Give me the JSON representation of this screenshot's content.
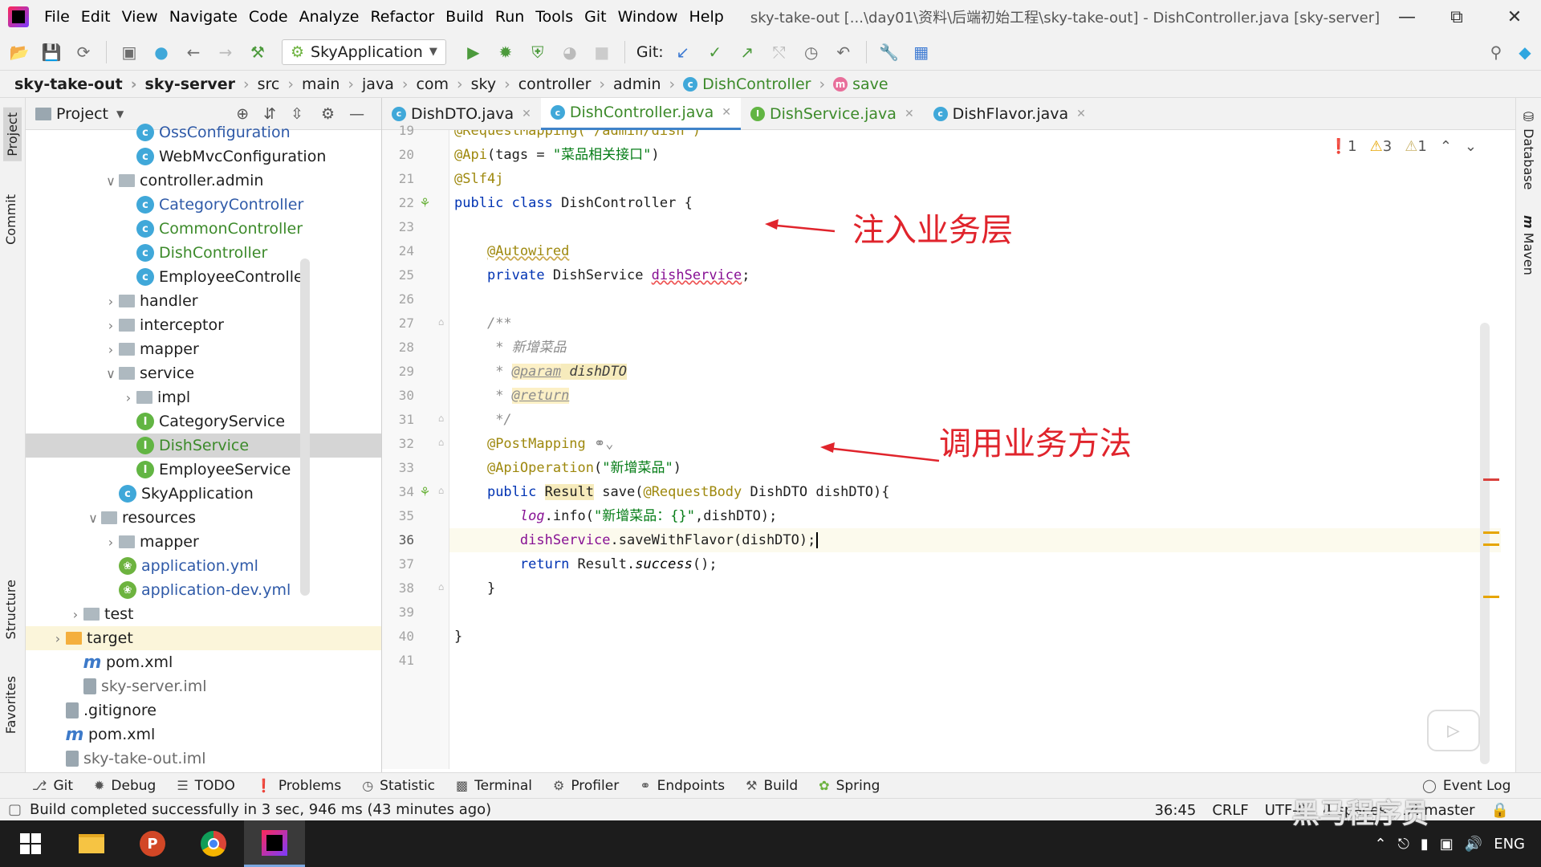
{
  "window": {
    "title": "sky-take-out [...\\day01\\资料\\后端初始工程\\sky-take-out] - DishController.java [sky-server]",
    "menu": [
      "File",
      "Edit",
      "View",
      "Navigate",
      "Code",
      "Analyze",
      "Refactor",
      "Build",
      "Run",
      "Tools",
      "Git",
      "Window",
      "Help"
    ],
    "controls": {
      "minimize": "—",
      "restore": "⧉",
      "close": "✕"
    }
  },
  "toolbar": {
    "run_config": "SkyApplication",
    "git_label": "Git:"
  },
  "breadcrumb": [
    "sky-take-out",
    "sky-server",
    "src",
    "main",
    "java",
    "com",
    "sky",
    "controller",
    "admin",
    "DishController",
    "save"
  ],
  "left_stripe": {
    "project": "Project",
    "commit": "Commit",
    "structure": "Structure",
    "favorites": "Favorites"
  },
  "project_panel": {
    "title": "Project",
    "tree": [
      {
        "label": "OssConfiguration",
        "icon": "class",
        "indent": 4,
        "arrow": "",
        "style": "blue"
      },
      {
        "label": "WebMvcConfiguration",
        "icon": "class",
        "indent": 4,
        "arrow": "",
        "style": ""
      },
      {
        "label": "controller.admin",
        "icon": "folder",
        "indent": 3,
        "arrow": "v",
        "style": ""
      },
      {
        "label": "CategoryController",
        "icon": "class",
        "indent": 4,
        "arrow": "",
        "style": "blue"
      },
      {
        "label": "CommonController",
        "icon": "class",
        "indent": 4,
        "arrow": "",
        "style": "green"
      },
      {
        "label": "DishController",
        "icon": "class",
        "indent": 4,
        "arrow": "",
        "style": "green"
      },
      {
        "label": "EmployeeController",
        "icon": "class",
        "indent": 4,
        "arrow": "",
        "style": ""
      },
      {
        "label": "handler",
        "icon": "folder",
        "indent": 3,
        "arrow": ">",
        "style": ""
      },
      {
        "label": "interceptor",
        "icon": "folder",
        "indent": 3,
        "arrow": ">",
        "style": ""
      },
      {
        "label": "mapper",
        "icon": "folder",
        "indent": 3,
        "arrow": ">",
        "style": ""
      },
      {
        "label": "service",
        "icon": "folder",
        "indent": 3,
        "arrow": "v",
        "style": ""
      },
      {
        "label": "impl",
        "icon": "folder",
        "indent": 4,
        "arrow": ">",
        "style": ""
      },
      {
        "label": "CategoryService",
        "icon": "intf",
        "indent": 4,
        "arrow": "",
        "style": ""
      },
      {
        "label": "DishService",
        "icon": "intf",
        "indent": 4,
        "arrow": "",
        "style": "green",
        "selected": true
      },
      {
        "label": "EmployeeService",
        "icon": "intf",
        "indent": 4,
        "arrow": "",
        "style": ""
      },
      {
        "label": "SkyApplication",
        "icon": "spring-class",
        "indent": 3,
        "arrow": "",
        "style": ""
      },
      {
        "label": "resources",
        "icon": "folder",
        "indent": 2,
        "arrow": "v",
        "style": ""
      },
      {
        "label": "mapper",
        "icon": "folder",
        "indent": 3,
        "arrow": ">",
        "style": ""
      },
      {
        "label": "application.yml",
        "icon": "spring",
        "indent": 3,
        "arrow": "",
        "style": "blue"
      },
      {
        "label": "application-dev.yml",
        "icon": "spring",
        "indent": 3,
        "arrow": "",
        "style": "blue"
      },
      {
        "label": "test",
        "icon": "folder",
        "indent": 1,
        "arrow": ">",
        "style": ""
      },
      {
        "label": "target",
        "icon": "folder-orange",
        "indent": 0,
        "arrow": ">",
        "style": "",
        "highlight": true
      },
      {
        "label": "pom.xml",
        "icon": "maven",
        "indent": 1,
        "arrow": "",
        "style": ""
      },
      {
        "label": "sky-server.iml",
        "icon": "file",
        "indent": 1,
        "arrow": "",
        "style": "gray"
      },
      {
        "label": ".gitignore",
        "icon": "file",
        "indent": 0,
        "arrow": "",
        "style": ""
      },
      {
        "label": "pom.xml",
        "icon": "maven",
        "indent": 0,
        "arrow": "",
        "style": ""
      },
      {
        "label": "sky-take-out.iml",
        "icon": "file",
        "indent": 0,
        "arrow": "",
        "style": "gray"
      }
    ]
  },
  "editor_tabs": [
    {
      "label": "DishDTO.java",
      "icon": "class",
      "active": false
    },
    {
      "label": "DishController.java",
      "icon": "class",
      "active": true
    },
    {
      "label": "DishService.java",
      "icon": "intf",
      "active": false
    },
    {
      "label": "DishFlavor.java",
      "icon": "class",
      "active": false
    }
  ],
  "inspections": {
    "errors": "1",
    "warnings": "3",
    "weak_warnings": "1"
  },
  "code": {
    "line_numbers": [
      "19",
      "20",
      "21",
      "22",
      "23",
      "24",
      "25",
      "26",
      "27",
      "28",
      "29",
      "30",
      "31",
      "32",
      "33",
      "34",
      "35",
      "36",
      "37",
      "38",
      "39",
      "40",
      "41"
    ],
    "current_line": "36",
    "l19": "@RequestMapping(\"/admin/dish\")",
    "l20a": "@Api",
    "l20b": "(tags = ",
    "l20c": "\"菜品相关接口\"",
    "l20d": ")",
    "l21": "@Slf4j",
    "l22a": "public class ",
    "l22b": "DishController {",
    "l24": "@Autowired",
    "l25a": "private ",
    "l25b": "DishService ",
    "l25c": "dishService",
    "l25d": ";",
    "l27": "/**",
    "l28": " * 新增菜品",
    "l29a": " * ",
    "l29b": "@param",
    "l29c": " dishDTO",
    "l30a": " * ",
    "l30b": "@return",
    "l31": " */",
    "l32": "@PostMapping",
    "l33a": "@ApiOperation",
    "l33b": "(",
    "l33c": "\"新增菜品\"",
    "l33d": ")",
    "l34a": "public ",
    "l34b": "Result",
    "l34c": " save(",
    "l34d": "@RequestBody",
    "l34e": " DishDTO dishDTO){",
    "l35a": "log",
    "l35b": ".info(",
    "l35c": "\"新增菜品：{}\"",
    "l35d": ",dishDTO);",
    "l36a": "dishService",
    "l36b": ".saveWithFlavor(dishDTO);",
    "l37a": "return ",
    "l37b": "Result.",
    "l37c": "success",
    "l37d": "();",
    "l38": "}",
    "l40": "}"
  },
  "annotations": {
    "inject": "注入业务层",
    "invoke": "调用业务方法",
    "color": "#e0242c"
  },
  "right_stripe": {
    "database": "Database",
    "maven": "Maven"
  },
  "bottom_tools": [
    "Git",
    "Debug",
    "TODO",
    "Problems",
    "Statistic",
    "Terminal",
    "Profiler",
    "Endpoints",
    "Build",
    "Spring"
  ],
  "event_log": "Event Log",
  "status": {
    "message": "Build completed successfully in 3 sec, 946 ms (43 minutes ago)",
    "position": "36:45",
    "line_sep": "CRLF",
    "encoding": "UTF-8",
    "indent": "4 spaces",
    "branch": "master"
  },
  "taskbar": {
    "tray_lang": "ENG"
  },
  "watermark": "黑马程序员"
}
